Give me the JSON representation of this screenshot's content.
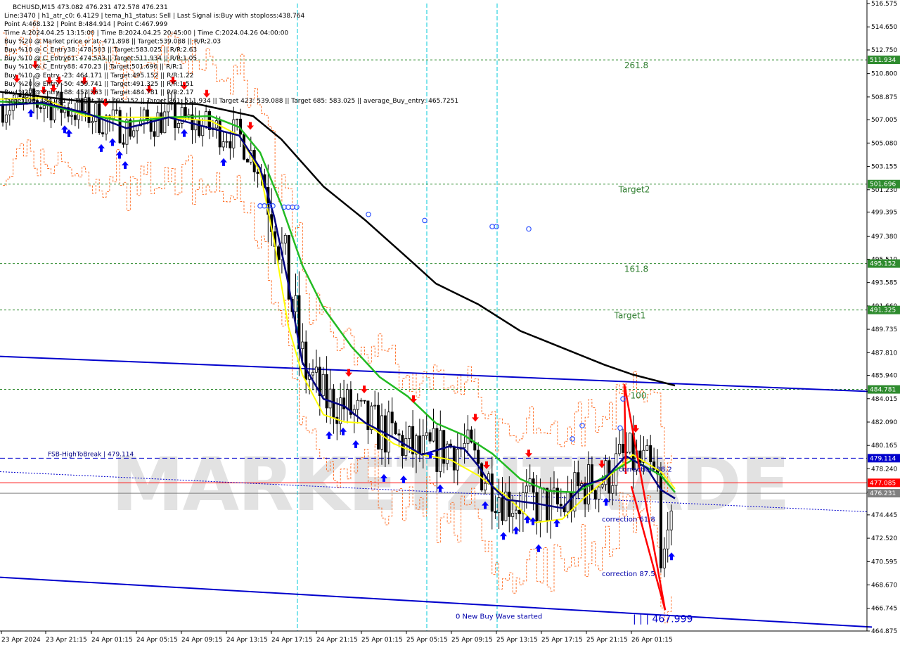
{
  "header": {
    "lines": [
      "BCHUSD,M15  473.082 476.231 472.578 476.231",
      "Line:3470  | h1_atr_c0: 6.4129  | tema_h1_status: Sell  | Last Signal is:Buy with stoploss:438.764",
      "Point A:468.132  | Point B:484.914  | Point C:467.999",
      "Time A:2024.04.25 13:15:00  | Time B:2024.04.25 20:45:00  | Time C:2024.04.26 04:00:00",
      "Buy %20 @ Market price or at: 471.898  || Target:539.088  || R/R:2.03",
      "Buy %10 @ C_Entry38: 478.503  || Target:583.025  || R/R:2.63",
      "Buy %10 @ C_Entry61: 474.543  || Target:511.934  || R/R:1.05",
      "Buy %10 @ C_Entry88: 470.23  || Target:501.696  || R/R:1",
      "Buy %10 @ Entry -23: 464.171  || Target:495.152  || R/R:1.22",
      "Buy %20 @ Entry -50: 459.741  || Target:491.325  || R/R:1.51",
      "Buy %20 @ Entry -88: 453.263  || Target:484.781  || R/R:2.17",
      "Target100: 484.781  || Target 161: 495.152  || Target 261: 511.934  || Target 423: 539.088  || Target 685: 583.025  || average_Buy_entry: 465.7251"
    ]
  },
  "watermark": "MARKETZITRADE",
  "colors": {
    "background": "#ffffff",
    "bull_candle": "#000000",
    "bear_candle": "#000000",
    "ema_slow": "#000000",
    "ema_green": "#22bb22",
    "ema_navy": "#000080",
    "ema_yellow": "#ffff00",
    "channel": "#0000cc",
    "target_lines": "#2e8b2e",
    "fsb_line": "#0000cc",
    "red_line": "#ff0000",
    "current_line": "#808080",
    "orange_band": "#ff5500",
    "buy_arrow": "#0000ff",
    "sell_arrow": "#ff0000",
    "cyan_vline": "#00c8d8"
  },
  "chart_data": {
    "type": "candlestick",
    "symbol": "BCHUSD",
    "timeframe": "M15",
    "ylim": [
      464.875,
      516.575
    ],
    "y_ticks": [
      "516.575",
      "514.650",
      "512.750",
      "510.800",
      "508.875",
      "507.005",
      "505.080",
      "503.155",
      "501.230",
      "499.395",
      "497.380",
      "495.510",
      "493.585",
      "491.660",
      "489.735",
      "487.810",
      "485.940",
      "484.015",
      "482.090",
      "480.165",
      "478.240",
      "476.325",
      "474.445",
      "472.520",
      "470.595",
      "468.670",
      "466.745",
      "464.875"
    ],
    "x_labels": [
      "23 Apr 2024",
      "23 Apr 21:15",
      "24 Apr 01:15",
      "24 Apr 05:15",
      "24 Apr 09:15",
      "24 Apr 13:15",
      "24 Apr 17:15",
      "24 Apr 21:15",
      "25 Apr 01:15",
      "25 Apr 05:15",
      "25 Apr 09:15",
      "25 Apr 13:15",
      "25 Apr 17:15",
      "25 Apr 21:15",
      "26 Apr 01:15"
    ],
    "horizontal_levels": [
      {
        "label": "261.8",
        "value": 511.934,
        "tag": "511.934",
        "color": "#2e8b2e",
        "style": "dotted"
      },
      {
        "label": "Target2",
        "value": 501.696,
        "tag": "501.696",
        "color": "#2e8b2e",
        "style": "dotted"
      },
      {
        "label": "161.8",
        "value": 495.152,
        "tag": "495.152",
        "color": "#2e8b2e",
        "style": "dotted"
      },
      {
        "label": "Target1",
        "value": 491.325,
        "tag": "491.325",
        "color": "#2e8b2e",
        "style": "dotted"
      },
      {
        "label": "100",
        "value": 484.781,
        "tag": "484.781",
        "color": "#2e8b2e",
        "style": "dotted"
      },
      {
        "label": "FSB-HighToBreak | 479.114",
        "value": 479.114,
        "tag": "479.114",
        "color": "#0000cc",
        "style": "dashed"
      },
      {
        "label": "",
        "value": 477.085,
        "tag": "477.085",
        "color": "#ff0000",
        "style": "solid"
      },
      {
        "label": "",
        "value": 476.231,
        "tag": "476.231",
        "color": "#808080",
        "style": "solid"
      }
    ],
    "annotations": [
      {
        "text": "correction 38.2",
        "x": "25 Apr 21:45",
        "y": 478.0
      },
      {
        "text": "correction 61.8",
        "x": "25 Apr 21:15",
        "y": 473.9
      },
      {
        "text": "correction 87.5",
        "x": "25 Apr 21:15",
        "y": 469.4
      },
      {
        "text": "0 New Buy Wave started",
        "x": "25 Apr 09:30",
        "y": 465.9
      },
      {
        "text": "| | | 467.999",
        "x": "26 Apr 01:30",
        "y": 465.6
      }
    ],
    "ema_black": [
      [
        0,
        509.3
      ],
      [
        60,
        508.9
      ],
      [
        120,
        508.5
      ],
      [
        200,
        508.4
      ],
      [
        280,
        508.3
      ],
      [
        360,
        507.3
      ],
      [
        400,
        505.4
      ],
      [
        460,
        501.5
      ],
      [
        520,
        498.7
      ],
      [
        580,
        495.6
      ],
      [
        620,
        493.5
      ],
      [
        680,
        491.8
      ],
      [
        740,
        489.6
      ],
      [
        800,
        488.2
      ],
      [
        860,
        486.8
      ],
      [
        900,
        486.0
      ],
      [
        960,
        485.1
      ]
    ],
    "ema_green": [
      [
        0,
        508.5
      ],
      [
        60,
        508.3
      ],
      [
        120,
        507.5
      ],
      [
        180,
        506.8
      ],
      [
        240,
        507.2
      ],
      [
        300,
        507.3
      ],
      [
        340,
        506.4
      ],
      [
        370,
        504.3
      ],
      [
        400,
        500.0
      ],
      [
        430,
        495.0
      ],
      [
        460,
        491.5
      ],
      [
        500,
        488.3
      ],
      [
        540,
        485.8
      ],
      [
        580,
        484.2
      ],
      [
        620,
        482.0
      ],
      [
        660,
        481.0
      ],
      [
        700,
        479.5
      ],
      [
        740,
        477.4
      ],
      [
        780,
        476.4
      ],
      [
        820,
        476.3
      ],
      [
        860,
        477.6
      ],
      [
        900,
        479.0
      ],
      [
        940,
        477.7
      ],
      [
        960,
        476.3
      ]
    ],
    "ema_navy": [
      [
        0,
        508.2
      ],
      [
        60,
        508.4
      ],
      [
        120,
        507.6
      ],
      [
        180,
        506.3
      ],
      [
        240,
        507.2
      ],
      [
        300,
        506.3
      ],
      [
        340,
        505.7
      ],
      [
        370,
        503.0
      ],
      [
        390,
        499.0
      ],
      [
        410,
        493.5
      ],
      [
        430,
        487.0
      ],
      [
        460,
        484.0
      ],
      [
        490,
        483.4
      ],
      [
        520,
        482.0
      ],
      [
        560,
        480.8
      ],
      [
        600,
        479.4
      ],
      [
        640,
        480.1
      ],
      [
        660,
        479.9
      ],
      [
        680,
        478.5
      ],
      [
        700,
        476.8
      ],
      [
        720,
        475.7
      ],
      [
        760,
        475.4
      ],
      [
        800,
        475.0
      ],
      [
        830,
        476.9
      ],
      [
        860,
        477.4
      ],
      [
        890,
        479.3
      ],
      [
        920,
        478.3
      ],
      [
        940,
        476.5
      ],
      [
        960,
        475.8
      ]
    ],
    "ema_yellow": [
      [
        0,
        508.7
      ],
      [
        60,
        508.8
      ],
      [
        120,
        507.3
      ],
      [
        180,
        507.2
      ],
      [
        240,
        507.2
      ],
      [
        300,
        506.9
      ],
      [
        340,
        505.7
      ],
      [
        370,
        502.7
      ],
      [
        390,
        497.0
      ],
      [
        410,
        490.0
      ],
      [
        430,
        486.0
      ],
      [
        460,
        482.7
      ],
      [
        490,
        482.1
      ],
      [
        520,
        482.0
      ],
      [
        560,
        480.3
      ],
      [
        600,
        479.4
      ],
      [
        640,
        479.0
      ],
      [
        680,
        477.7
      ],
      [
        720,
        476.0
      ],
      [
        760,
        473.8
      ],
      [
        800,
        474.1
      ],
      [
        830,
        475.8
      ],
      [
        860,
        477.3
      ],
      [
        900,
        479.4
      ],
      [
        940,
        478.0
      ],
      [
        960,
        476.6
      ]
    ],
    "channel_upper": [
      [
        0,
        487.5
      ],
      [
        1240,
        484.6
      ]
    ],
    "channel_lower": [
      [
        0,
        469.3
      ],
      [
        1240,
        465.2
      ]
    ],
    "red_zigzag": [
      [
        888,
        485.2
      ],
      [
        946,
        466.6
      ],
      [
        890,
        477.8
      ]
    ],
    "tick_symbol_labels": []
  }
}
